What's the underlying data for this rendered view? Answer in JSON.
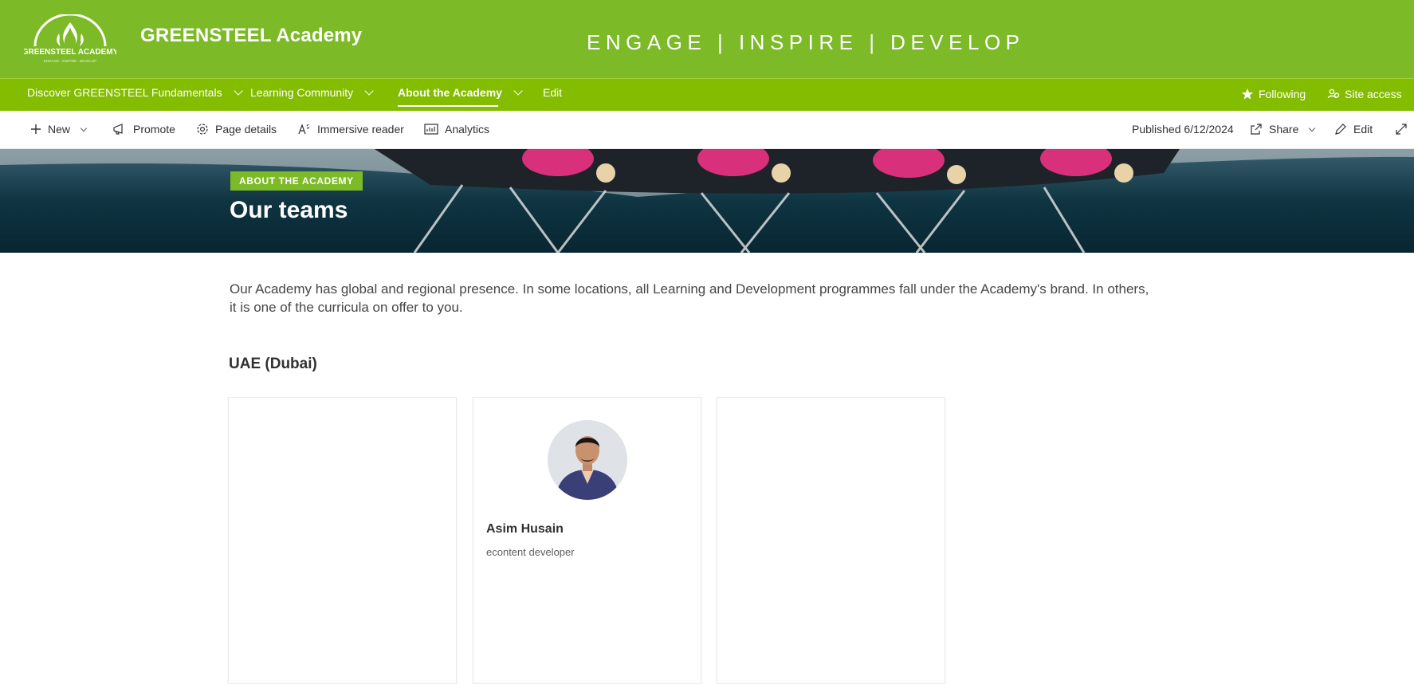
{
  "header": {
    "logo_text": "GREENSTEEL ACADEMY",
    "logo_subtext": "ENGAGE · INSPIRE · DEVELOP",
    "site_title": "GREENSTEEL Academy",
    "tagline": "ENGAGE  |  INSPIRE  |  DEVELOP",
    "brand_color": "#7cba27"
  },
  "nav": {
    "items": [
      {
        "label": "Discover GREENSTEEL Fundamentals",
        "has_menu": true,
        "active": false
      },
      {
        "label": "Learning Community",
        "has_menu": true,
        "active": false
      },
      {
        "label": "About the Academy",
        "has_menu": true,
        "active": true
      },
      {
        "label": "Edit",
        "has_menu": false,
        "active": false
      }
    ],
    "following_label": "Following",
    "site_access_label": "Site access",
    "nav_color": "#84bd00"
  },
  "command_bar": {
    "new_label": "New",
    "promote_label": "Promote",
    "page_details_label": "Page details",
    "immersive_reader_label": "Immersive reader",
    "analytics_label": "Analytics",
    "published_label": "Published 6/12/2024",
    "share_label": "Share",
    "edit_label": "Edit"
  },
  "hero": {
    "badge": "ABOUT THE ACADEMY",
    "title": "Our teams"
  },
  "content": {
    "intro": "Our Academy has global and regional presence. In some locations, all Learning and Development programmes fall under the Academy's brand. In others, it is one of the curricula on offer to you.",
    "section_title": "UAE (Dubai)",
    "cards": [
      {
        "name": "",
        "role": ""
      },
      {
        "name": "Asim Husain",
        "role": "econtent developer"
      },
      {
        "name": "",
        "role": ""
      }
    ]
  }
}
